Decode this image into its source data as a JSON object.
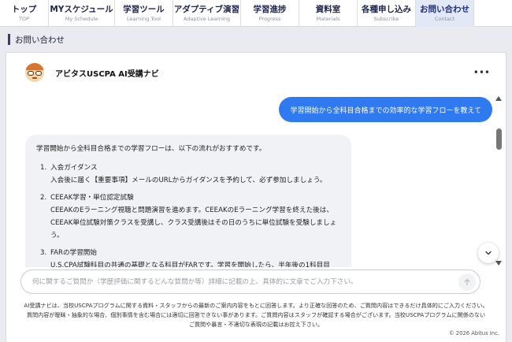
{
  "nav": {
    "items": [
      {
        "label": "トップ",
        "sub": "TOP"
      },
      {
        "label": "MYスケジュール",
        "sub": "My Schedule"
      },
      {
        "label": "学習ツール",
        "sub": "Learning Tool"
      },
      {
        "label": "アダプティブ演習",
        "sub": "Adaptive Learning"
      },
      {
        "label": "学習進捗",
        "sub": "Progress"
      },
      {
        "label": "資料室",
        "sub": "Materials"
      },
      {
        "label": "各種申し込み",
        "sub": "Subscribe"
      },
      {
        "label": "お問い合わせ",
        "sub": "Contact"
      }
    ],
    "active_index": 7
  },
  "page": {
    "title": "お問い合わせ"
  },
  "chat": {
    "bot_name": "アビタスUSCPA AI受講ナビ",
    "more_label": "•••",
    "user_message": "学習開始から全科目合格までの効率的な学習フローを教えて",
    "bot_intro": "学習開始から全科目合格までの学習フローは、以下の流れがおすすめです。",
    "steps": [
      {
        "num": "1.",
        "title": "入会ガイダンス",
        "desc": "入会後に届く【重要事項】メールのURLからガイダンスを予約して、必ず参加しましょう。"
      },
      {
        "num": "2.",
        "title": "CEEAK学習・単位認定試験",
        "desc": "CEEAKのEラーニング視聴と問題演習を進めます。CEEAKのEラーニング学習を終えた後は、CEEAK単位試験対策クラスを受講し、クラス受講後はその日のうちに単位試験を受験しましょう。"
      },
      {
        "num": "3.",
        "title": "FARの学習開始",
        "desc": "U.S.CPA試験科目の共通の基礎となる科目がFARです。学習を開始したら、半年後の1科目目"
      }
    ]
  },
  "input": {
    "placeholder": "何に関するご質問か（学歴評価に関するどんな質問か等）詳細に記載の上、具体的に文章でご入力下さい。"
  },
  "disclaimer": {
    "lines": [
      "AI受講ナビは、当校USCPAプログラムに関する資料・スタッフからの最新のご案内内容をもとに回答します。より正確な回答のため、ご質問内容はできるだけ具体的にご入力ください。",
      "質問内容が曖昧・抽象的な場合、個別事情を含む場合には適切に回答できない事があります。ご質問内容はスタッフが確認する場合がございます。当校USCPAプログラムに関係のない",
      "ご質問や暴言・不適切な表現の記載はお控え下さい。"
    ]
  },
  "footer": {
    "copyright": "© 2026 Abitus Inc."
  },
  "colors": {
    "accent": "#2f7af0",
    "nav_active": "#e3e8f6",
    "bubble_bg": "#f1f2f5"
  }
}
